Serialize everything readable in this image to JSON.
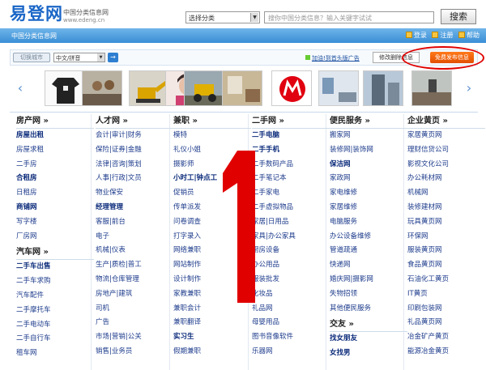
{
  "header": {
    "logo_main": "易登网",
    "logo_sub": "中国分类信息网",
    "logo_url": "www.edeng.cn",
    "category_select": "选择分类",
    "search_placeholder": "搜你中国分类信息？输入关键字试试",
    "search_button": "搜索"
  },
  "navbar": {
    "title": "中国分类信息网",
    "login": "登录",
    "register": "注册",
    "help": "帮助"
  },
  "toolbar": {
    "location": "切换城市",
    "pinyin": "中文/拼音",
    "go": "→",
    "ad_link": "加油!到首头版广告",
    "edit_button": "修改删除信息",
    "publish_button": "免费发布信息"
  },
  "annotation": {
    "number": "1",
    "ellipse_color": "#e00000"
  },
  "carousel": {
    "prev": "‹",
    "next": "›"
  },
  "columns": [
    {
      "sections": [
        {
          "title": "房产网 »",
          "items": [
            {
              "t": "房屋出租",
              "b": true
            },
            {
              "t": "房屋求租",
              "b": false
            },
            {
              "t": "二手房",
              "b": false
            },
            {
              "t": "合租房",
              "b": true
            },
            {
              "t": "日租房",
              "b": false
            },
            {
              "t": "商铺网",
              "b": true
            },
            {
              "t": "写字楼",
              "b": false
            },
            {
              "t": "厂房网",
              "b": false
            }
          ]
        },
        {
          "title": "汽车网 »",
          "items": [
            {
              "t": "二手车出售",
              "b": true
            },
            {
              "t": "二手车求购",
              "b": false
            },
            {
              "t": "汽车配件",
              "b": false
            },
            {
              "t": "二手摩托车",
              "b": false
            },
            {
              "t": "二手电动车",
              "b": false
            },
            {
              "t": "二手自行车",
              "b": false
            },
            {
              "t": "租车网",
              "b": false
            }
          ]
        }
      ]
    },
    {
      "sections": [
        {
          "title": "人才网 »",
          "items": [
            {
              "t": "会计|审计|财务",
              "b": false
            },
            {
              "t": "保险|证券|金融",
              "b": false
            },
            {
              "t": "法律|咨询|策划",
              "b": false
            },
            {
              "t": "人事|行政|文员",
              "b": false
            },
            {
              "t": "物业保安",
              "b": false
            },
            {
              "t": "经理管理",
              "b": true
            },
            {
              "t": "客服|前台",
              "b": false
            },
            {
              "t": "电子",
              "b": false
            },
            {
              "t": "机械|仪表",
              "b": false
            },
            {
              "t": "生产|质检|普工",
              "b": false
            },
            {
              "t": "物流|仓库管理",
              "b": false
            },
            {
              "t": "房地产|建筑",
              "b": false
            },
            {
              "t": "司机",
              "b": false
            },
            {
              "t": "广告",
              "b": false
            },
            {
              "t": "市场|营销|公关",
              "b": false
            },
            {
              "t": "销售|业务员",
              "b": false
            }
          ]
        }
      ]
    },
    {
      "sections": [
        {
          "title": "兼职 »",
          "items": [
            {
              "t": "模特",
              "b": false
            },
            {
              "t": "礼仪小姐",
              "b": false
            },
            {
              "t": "摄影师",
              "b": false
            },
            {
              "t": "小时工|钟点工",
              "b": true
            },
            {
              "t": "促销员",
              "b": false
            },
            {
              "t": "传单派发",
              "b": false
            },
            {
              "t": "问卷调查",
              "b": false
            },
            {
              "t": "打字录入",
              "b": false
            },
            {
              "t": "网络兼职",
              "b": false
            },
            {
              "t": "网站制作",
              "b": false
            },
            {
              "t": "设计制作",
              "b": false
            },
            {
              "t": "家教兼职",
              "b": false
            },
            {
              "t": "兼职会计",
              "b": false
            },
            {
              "t": "兼职翻译",
              "b": false
            },
            {
              "t": "实习生",
              "b": true
            },
            {
              "t": "假期兼职",
              "b": false
            }
          ]
        }
      ]
    },
    {
      "sections": [
        {
          "title": "二手网 »",
          "items": [
            {
              "t": "二手电脑",
              "b": true
            },
            {
              "t": "二手手机",
              "b": true
            },
            {
              "t": "二手数码产品",
              "b": false
            },
            {
              "t": "二手笔记本",
              "b": false
            },
            {
              "t": "二手家电",
              "b": false
            },
            {
              "t": "二手虚拟物品",
              "b": false
            },
            {
              "t": "家居|日用品",
              "b": false
            },
            {
              "t": "家具|办公家具",
              "b": false
            },
            {
              "t": "厨房设备",
              "b": false
            },
            {
              "t": "办公用品",
              "b": false
            },
            {
              "t": "服装批发",
              "b": false
            },
            {
              "t": "化妆品",
              "b": false
            },
            {
              "t": "礼品网",
              "b": false
            },
            {
              "t": "母婴用品",
              "b": false
            },
            {
              "t": "图书音像软件",
              "b": false
            },
            {
              "t": "乐器网",
              "b": false
            }
          ]
        }
      ]
    },
    {
      "sections": [
        {
          "title": "便民服务 »",
          "items": [
            {
              "t": "搬家网",
              "b": false
            },
            {
              "t": "装修网|装饰网",
              "b": false
            },
            {
              "t": "保洁网",
              "b": true
            },
            {
              "t": "家政网",
              "b": false
            },
            {
              "t": "家电维修",
              "b": false
            },
            {
              "t": "家居维修",
              "b": false
            },
            {
              "t": "电脑服务",
              "b": false
            },
            {
              "t": "办公设备维修",
              "b": false
            },
            {
              "t": "管道疏通",
              "b": false
            },
            {
              "t": "快递网",
              "b": false
            },
            {
              "t": "婚庆网|摄影网",
              "b": false
            },
            {
              "t": "失物招领",
              "b": false
            },
            {
              "t": "其他便民服务",
              "b": false
            }
          ]
        },
        {
          "title": "交友 »",
          "items": [
            {
              "t": "找女朋友",
              "b": true
            },
            {
              "t": "女找男",
              "b": true
            }
          ]
        }
      ]
    },
    {
      "sections": [
        {
          "title": "企业黄页 »",
          "items": [
            {
              "t": "家居黄页网",
              "b": false
            },
            {
              "t": "理财信贷公司",
              "b": false
            },
            {
              "t": "影视文化公司",
              "b": false
            },
            {
              "t": "办公耗材网",
              "b": false
            },
            {
              "t": "机械网",
              "b": false
            },
            {
              "t": "装修建材网",
              "b": false
            },
            {
              "t": "玩具黄页网",
              "b": false
            },
            {
              "t": "环保网",
              "b": false
            },
            {
              "t": "服装黄页网",
              "b": false
            },
            {
              "t": "食品黄页网",
              "b": false
            },
            {
              "t": "石油化工黄页",
              "b": false
            },
            {
              "t": "IT黄页",
              "b": false
            },
            {
              "t": "印刷包装网",
              "b": false
            },
            {
              "t": "礼品黄页网",
              "b": false
            },
            {
              "t": "冶金矿产黄页",
              "b": false
            },
            {
              "t": "能源冶金黄页",
              "b": false
            }
          ]
        }
      ]
    }
  ]
}
